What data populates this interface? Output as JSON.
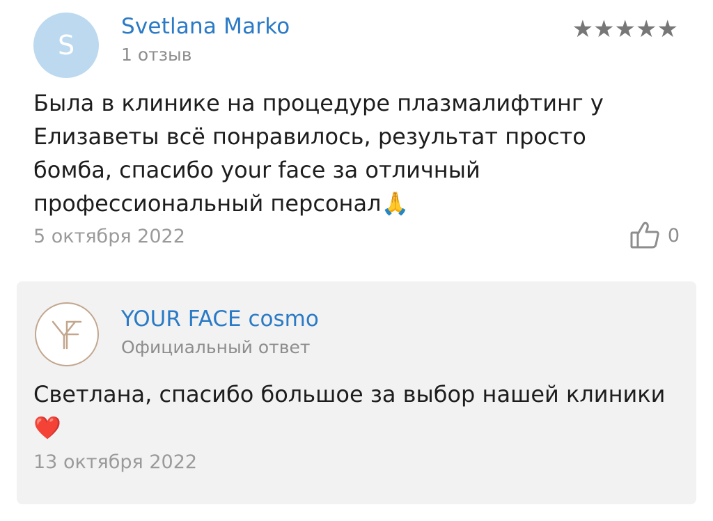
{
  "review": {
    "avatar_letter": "S",
    "author_name": "Svetlana Marko",
    "author_meta": "1 отзыв",
    "stars": "★★★★★",
    "rating": 5,
    "text": "Была в клинике на процедуре плазмалифтинг у Елизаветы всё понравилось, результат просто бомба, спасибо your face за отличный профессиональный персонал🙏",
    "date": "5 октября 2022",
    "likes": "0",
    "colors": {
      "name": "#2a7ac6",
      "avatar_bg": "#bcd9ef",
      "stars": "#777777"
    }
  },
  "reply": {
    "logo_icon": "yf-monogram-logo",
    "name": "YOUR FACE cosmo",
    "meta": "Официальный ответ",
    "text": "Светлана, спасибо большое за выбор нашей клиники❤️",
    "date": "13 октября 2022",
    "colors": {
      "background": "#f2f2f2",
      "logo_border": "#c2a68e"
    }
  }
}
